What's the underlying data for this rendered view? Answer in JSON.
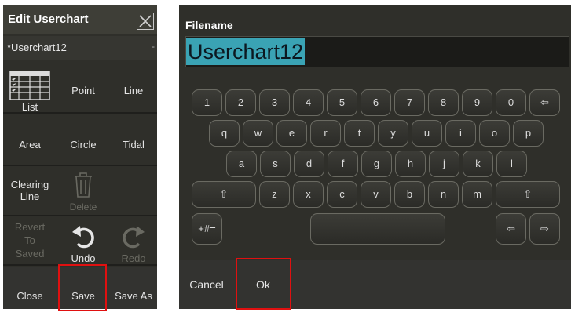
{
  "left_panel": {
    "title": "Edit Userchart",
    "filename": "*Userchart12",
    "filename_suffix": "-",
    "tools": {
      "list": "List",
      "point": "Point",
      "line": "Line",
      "area": "Area",
      "circle": "Circle",
      "tidal": "Tidal",
      "clearing_line": "Clearing\nLine",
      "delete": "Delete",
      "revert": "Revert\nTo\nSaved",
      "undo": "Undo",
      "redo": "Redo",
      "close": "Close",
      "save": "Save",
      "save_as": "Save As"
    }
  },
  "right_panel": {
    "filename_label": "Filename",
    "filename_value": "Userchart12",
    "keys": {
      "row1": [
        "1",
        "2",
        "3",
        "4",
        "5",
        "6",
        "7",
        "8",
        "9",
        "0",
        "⇦"
      ],
      "row2": [
        "q",
        "w",
        "e",
        "r",
        "t",
        "y",
        "u",
        "i",
        "o",
        "p"
      ],
      "row3": [
        "a",
        "s",
        "d",
        "f",
        "g",
        "h",
        "j",
        "k",
        "l"
      ],
      "row4": [
        "⇧",
        "z",
        "x",
        "c",
        "v",
        "b",
        "n",
        "m",
        "⇧"
      ],
      "row5": [
        "+#=",
        "",
        "⇦",
        "⇨"
      ]
    },
    "cancel": "Cancel",
    "ok": "Ok"
  },
  "colors": {
    "panel_bg": "#2f2f2a",
    "selection": "#3aa3b4",
    "highlight": "#e01010",
    "disabled_text": "#6a6a62"
  }
}
